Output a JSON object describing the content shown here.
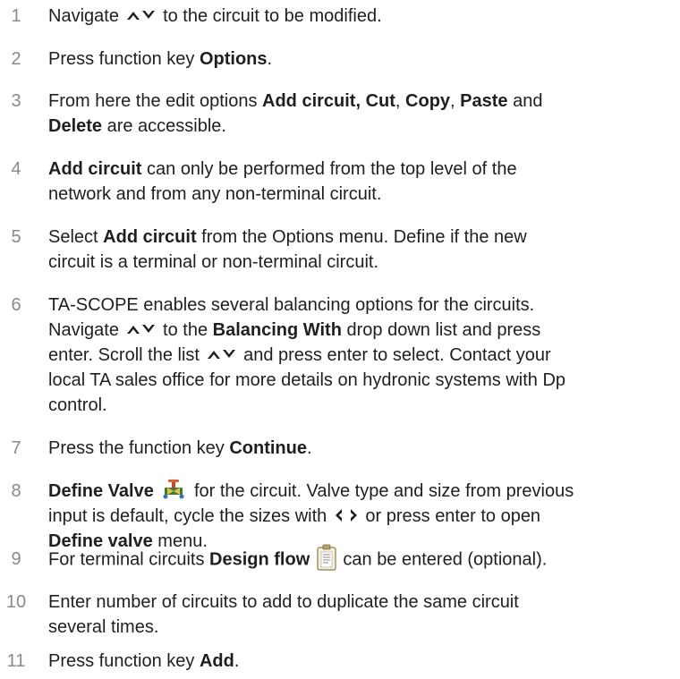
{
  "steps": [
    {
      "number": "1",
      "parts": [
        "Navigate",
        "to the circuit to be modified."
      ]
    },
    {
      "number": "2",
      "parts": [
        "Press function key ",
        "Options",
        "."
      ]
    },
    {
      "number": "3",
      "parts": [
        "From here the edit options ",
        "Add circuit, Cut",
        ", ",
        "Copy",
        ", ",
        "Paste",
        " and",
        "Delete",
        " are accessible."
      ]
    },
    {
      "number": "4",
      "parts": [
        "Add circuit",
        " can only be performed from the top level of the",
        "network and from any non-terminal circuit."
      ]
    },
    {
      "number": "5",
      "parts": [
        "Select ",
        "Add circuit",
        " from the Options menu. Define if the new",
        "circuit is a terminal or non-terminal circuit."
      ]
    },
    {
      "number": "6",
      "parts": [
        "TA-SCOPE enables several balancing options for the circuits.",
        "Navigate",
        " to the ",
        "Balancing With",
        " drop down list and press",
        "enter. Scroll the list",
        " and press enter to select. Contact your",
        "local TA sales office for more details on hydronic systems with Dp",
        "control."
      ]
    },
    {
      "number": "7",
      "parts": [
        "Press the function key ",
        "Continue",
        "."
      ]
    },
    {
      "number": "8",
      "parts": [
        "Define Valve",
        " for the circuit. Valve type and size from previous",
        "input is default, cycle the sizes with",
        " or press enter to open",
        "Define valve",
        " menu."
      ]
    },
    {
      "number": "9",
      "parts": [
        "For terminal circuits ",
        "Design flow",
        " can be entered (optional)."
      ]
    },
    {
      "number": "10",
      "parts": [
        "Enter number of circuits to add to duplicate the same circuit",
        "several times."
      ]
    },
    {
      "number": "11",
      "parts": [
        "Press function key ",
        "Add",
        "."
      ]
    }
  ],
  "icons": {
    "nav_arrows": "up-down-arrows-icon",
    "lr_arrows": "left-right-arrows-icon",
    "valve": "valve-icon",
    "design_flow": "clipboard-icon"
  }
}
